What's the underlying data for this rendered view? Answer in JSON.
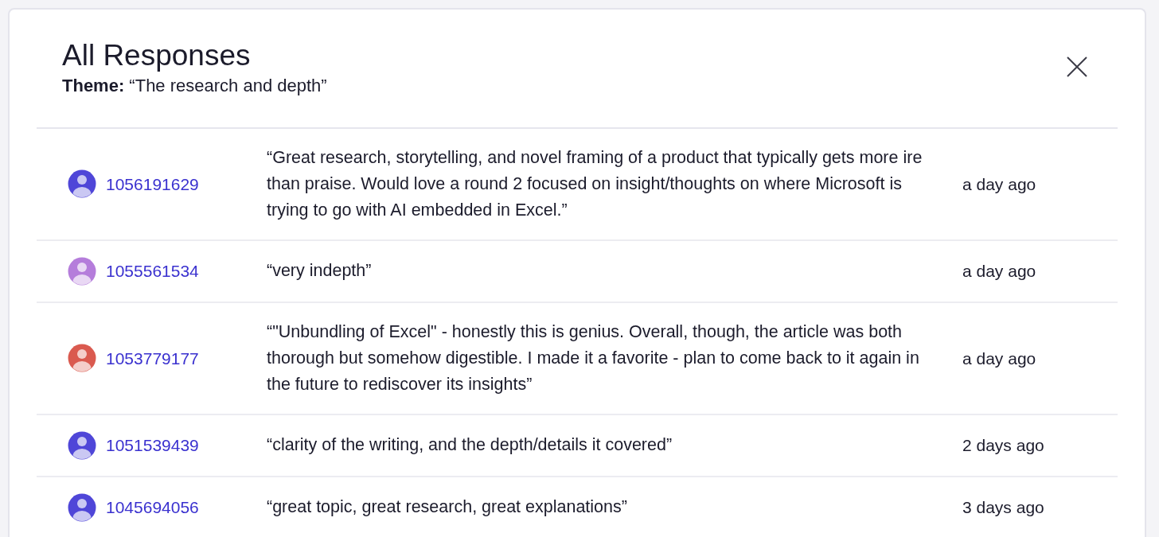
{
  "dialog": {
    "title": "All Responses",
    "theme": "**Theme:** “The research and depth”"
  },
  "responses": [
    {
      "id": "1056191629",
      "color": "#4f46d8",
      "text": "“Great research, storytelling, and novel framing of a product that typically gets more ire than praise. Would love a round 2 focused on insight/thoughts on where Microsoft is trying to go with AI embedded in Excel.”",
      "time": "a day ago"
    },
    {
      "id": "1055561534",
      "color": "#b57ddb",
      "text": "“very indepth”",
      "time": "a day ago"
    },
    {
      "id": "1053779177",
      "color": "#da5a4f",
      "text": "“\"Unbundling of Excel\" - honestly this is genius. Overall, though, the article was both thorough but somehow digestible. I made it a favorite - plan to come back to it again in the future to rediscover its insights”",
      "time": "a day ago"
    },
    {
      "id": "1051539439",
      "color": "#4f46d8",
      "text": "“clarity of the writing, and the depth/details it covered”",
      "time": "2 days ago"
    },
    {
      "id": "1045694056",
      "color": "#4f46d8",
      "text": "“great topic, great research, great explanations”",
      "time": "3 days ago"
    }
  ]
}
